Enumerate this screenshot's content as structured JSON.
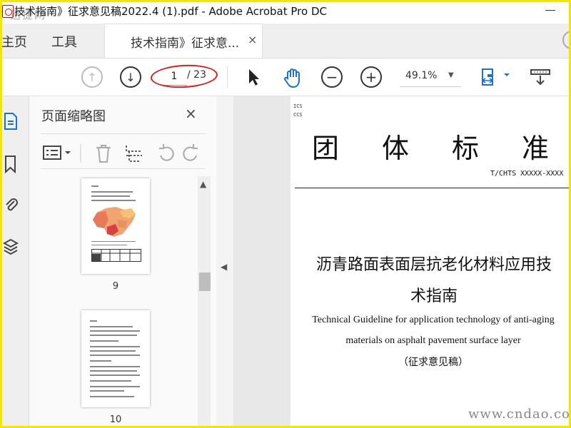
{
  "window": {
    "title": "技术指南》征求意见稿2022.4 (1).pdf - Adobe Acrobat Pro DC"
  },
  "tabs": {
    "home": "主页",
    "tools": "工具",
    "document": "技术指南》征求意...",
    "close": "×"
  },
  "toolbar": {
    "current_page": "1",
    "total_pages": "/ 23",
    "zoom": "49.1%"
  },
  "thumbnails": {
    "title": "页面缩略图",
    "close": "×",
    "pages": [
      {
        "label": "9"
      },
      {
        "label": "10"
      }
    ]
  },
  "document": {
    "ics_lines": [
      "ICS",
      "CCS"
    ],
    "big_title_chars": [
      "团",
      "体",
      "标",
      "准"
    ],
    "standard_number": "T/CHTS XXXXX-XXXX",
    "cn_title_line1": "沥青路面表面层抗老化材料应用技",
    "cn_title_line2": "术指南",
    "en_title_line1": "Technical Guideline for application technology of anti-aging",
    "en_title_line2": "materials on asphalt pavement surface layer",
    "draft_label": "（征求意见稿）"
  },
  "watermarks": {
    "top_left": "迅捷网",
    "bottom_right": "www.cndao.com"
  },
  "colors": {
    "highlight": "#d42020",
    "accent_blue": "#1a73c7",
    "frame": "#f5e600"
  },
  "icons": [
    "pdf-app-icon",
    "prev-page-icon",
    "next-page-icon",
    "select-cursor-icon",
    "hand-tool-icon",
    "zoom-out-icon",
    "zoom-in-icon",
    "fit-page-icon",
    "scan-icon",
    "pages-panel-icon",
    "bookmark-icon",
    "attachment-icon",
    "layers-icon",
    "options-icon",
    "delete-icon",
    "extract-icon",
    "rotate-left-icon",
    "rotate-right-icon"
  ]
}
